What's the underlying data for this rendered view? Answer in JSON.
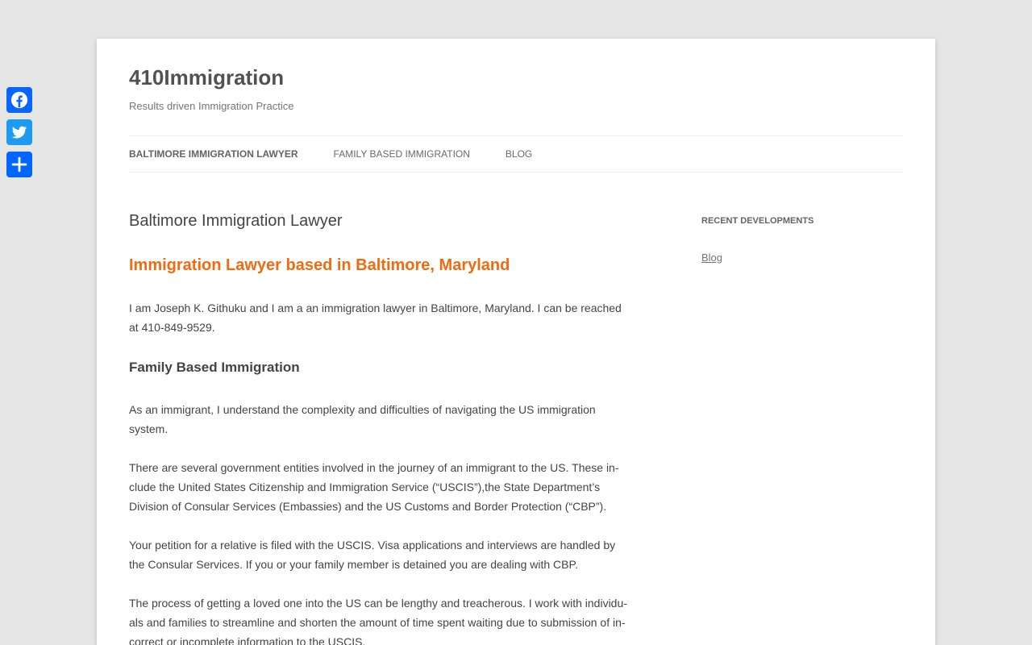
{
  "share": {
    "buttons": [
      {
        "name": "Facebook",
        "icon": "facebook-icon",
        "color": "#0866ff"
      },
      {
        "name": "Twitter",
        "icon": "twitter-icon",
        "color": "#1d9bf0"
      },
      {
        "name": "Share",
        "icon": "share-plus-icon",
        "color": "#0166ff"
      }
    ]
  },
  "header": {
    "site_title": "410Immigration",
    "site_description": "Results driven Immigration Practice"
  },
  "nav": {
    "items": [
      {
        "label": "BALTIMORE IMMIGRATION LAWYER",
        "current": true
      },
      {
        "label": "FAMILY BASED IMMIGRATION",
        "current": false
      },
      {
        "label": "BLOG",
        "current": false
      }
    ]
  },
  "main": {
    "entry_title": "Baltimore Immigration Lawyer",
    "heading_orange": "Immigration Lawyer based in Baltimore, Maryland",
    "intro": "I am Joseph K. Githuku and I am a an immigration lawyer in Baltimore, Maryland. I can be reached at 410-849-9529.",
    "heading_family": "Family Based Immigration",
    "paragraphs": [
      "As an immigrant, I understand the complexity and difficulties of navigating the US immigration system.",
      "There are several government entities involved in the journey of an immigrant to the US. These in­clude the United States Citizenship and Immigration Service (“USCIS”),the State Department’s Division of Consular Services (Embassies) and the US Customs and Border Protection (“CBP”).",
      "Your petition for a relative is filed with the USCIS. Visa applications and interviews are handled by the Consular Services. If you or your family member is detained you are dealing with CBP.",
      "The process of getting a loved one into the US can be lengthy and treacherous. I work with individu­als and families to streamline and shorten the amount of time spent waiting due to submission of in­correct or incomplete information to the USCIS."
    ]
  },
  "sidebar": {
    "widget_title": "RECENT DEVELOPMENTS",
    "link": "Blog"
  },
  "colors": {
    "accent_orange": "#f26a0f",
    "background": "#e6e6e6"
  }
}
